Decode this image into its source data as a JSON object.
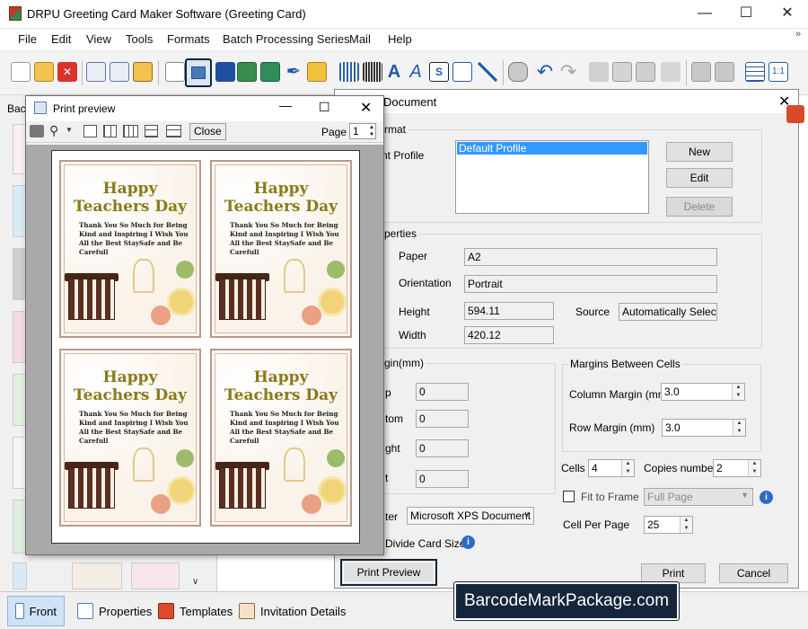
{
  "window": {
    "title": "DRPU Greeting Card Maker Software (Greeting Card)"
  },
  "menu": [
    "File",
    "Edit",
    "View",
    "Tools",
    "Formats",
    "Batch Processing Series",
    "Mail",
    "Help"
  ],
  "left_panel": {
    "label": "Bac"
  },
  "bottom_tabs": [
    {
      "label": "Front",
      "active": true
    },
    {
      "label": "Properties"
    },
    {
      "label": "Templates"
    },
    {
      "label": "Invitation Details"
    }
  ],
  "watermark": "BarcodeMarkPackage.com",
  "print_dialog": {
    "title": "Document",
    "format_group": "rmat",
    "profile_label": "nt Profile",
    "profiles": [
      "Default Profile"
    ],
    "buttons": {
      "new": "New",
      "edit": "Edit",
      "delete": "Delete"
    },
    "properties_group": "perties",
    "paper_label": "Paper",
    "paper_value": "A2",
    "orientation_label": "Orientation",
    "orientation_value": "Portrait",
    "height_label": "Height",
    "height_value": "594.11",
    "width_label": "Width",
    "width_value": "420.12",
    "source_label": "Source",
    "source_value": "Automatically Select",
    "margin_group": "gin(mm)",
    "margin_labels": [
      "p",
      "tom",
      "ght",
      "t"
    ],
    "margin_values": [
      "0",
      "0",
      "0",
      "0"
    ],
    "between_group": "Margins Between Cells",
    "column_margin_label": "Column Margin (mm)",
    "column_margin_value": "3.0",
    "row_margin_label": "Row Margin (mm)",
    "row_margin_value": "3.0",
    "cells_label": "Cells",
    "cells_value": "4",
    "copies_label": "Copies number",
    "copies_value": "2",
    "fit_label": "Fit to Frame",
    "fit_checked": false,
    "page_select": "Full Page",
    "cell_per_page_label": "Cell Per Page",
    "cell_per_page_value": "25",
    "printer_label": "ter",
    "printer_value": "Microsoft XPS Document",
    "divide_label": "Divide Card Size",
    "print_preview_button": "Print Preview",
    "print_button": "Print",
    "cancel_button": "Cancel"
  },
  "preview": {
    "title": "Print preview",
    "close_button": "Close",
    "page_label": "Page",
    "page_value": "1",
    "cards": [
      {
        "heading_1": "Happy",
        "heading_2": "Teachers Day",
        "body": "Thank You So Much for Being Kind and Inspiring I Wish You All the Best StaySafe and Be Carefull"
      },
      {
        "heading_1": "Happy",
        "heading_2": "Teachers Day",
        "body": "Thank You So Much for Being Kind and Inspiring I Wish You All the Best StaySafe and Be Carefull"
      },
      {
        "heading_1": "Happy",
        "heading_2": "Teachers Day",
        "body": "Thank You So Much for Being Kind and Inspiring I Wish You All the Best StaySafe and Be Carefull"
      },
      {
        "heading_1": "Happy",
        "heading_2": "Teachers Day",
        "body": "Thank You So Much for Being Kind and Inspiring I Wish You All the Best StaySafe and Be Carefull"
      }
    ]
  },
  "colors": {
    "accent": "#15253a",
    "selection": "#3399ff",
    "card_title": "#8a7a1a"
  }
}
